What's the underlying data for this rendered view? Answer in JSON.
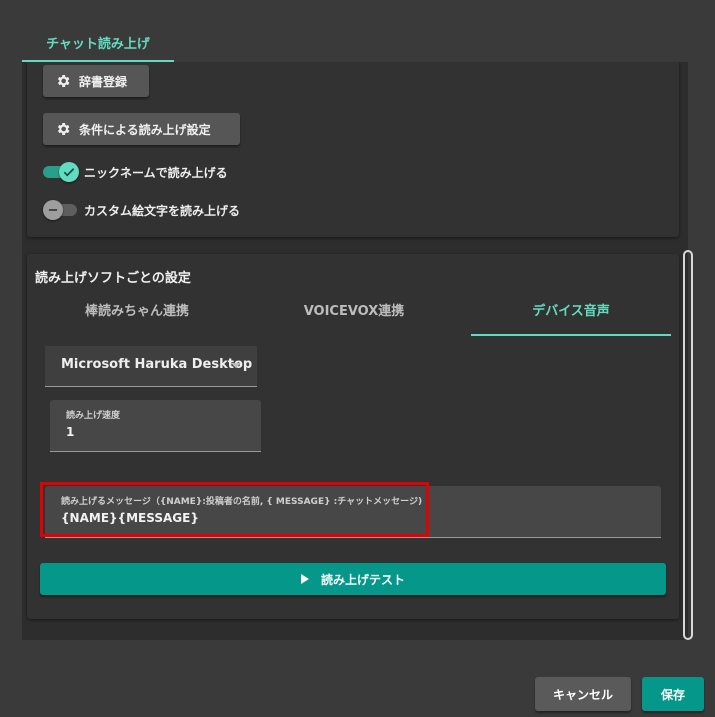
{
  "header": {
    "tab_label": "チャット読み上げ"
  },
  "settings": {
    "dictionary_button": "辞書登録",
    "conditional_button": "条件による読み上げ設定",
    "nickname_toggle": {
      "label": "ニックネームで読み上げる",
      "checked": true
    },
    "emoji_toggle": {
      "label": "カスタム絵文字を読み上げる",
      "checked": false
    }
  },
  "software": {
    "title": "読み上げソフトごとの設定",
    "tabs": [
      {
        "label": "棒読みちゃん連携",
        "active": false
      },
      {
        "label": "VOICEVOX連携",
        "active": false
      },
      {
        "label": "デバイス音声",
        "active": true
      }
    ],
    "voice_select": {
      "value": "Microsoft Haruka Desktop"
    },
    "speed_field": {
      "label": "読み上げ速度",
      "value": "1"
    },
    "message_field": {
      "label": "読み上げるメッセージ（{NAME}:投稿者の名前, { MESSAGE} :チャットメッセージ)",
      "value": "{NAME}{MESSAGE}"
    },
    "test_button": "読み上げテスト"
  },
  "footer": {
    "cancel_label": "キャンセル",
    "save_label": "保存"
  },
  "colors": {
    "accent": "#62dcc0",
    "primary_button": "#04978a",
    "highlight": "#e20000"
  }
}
